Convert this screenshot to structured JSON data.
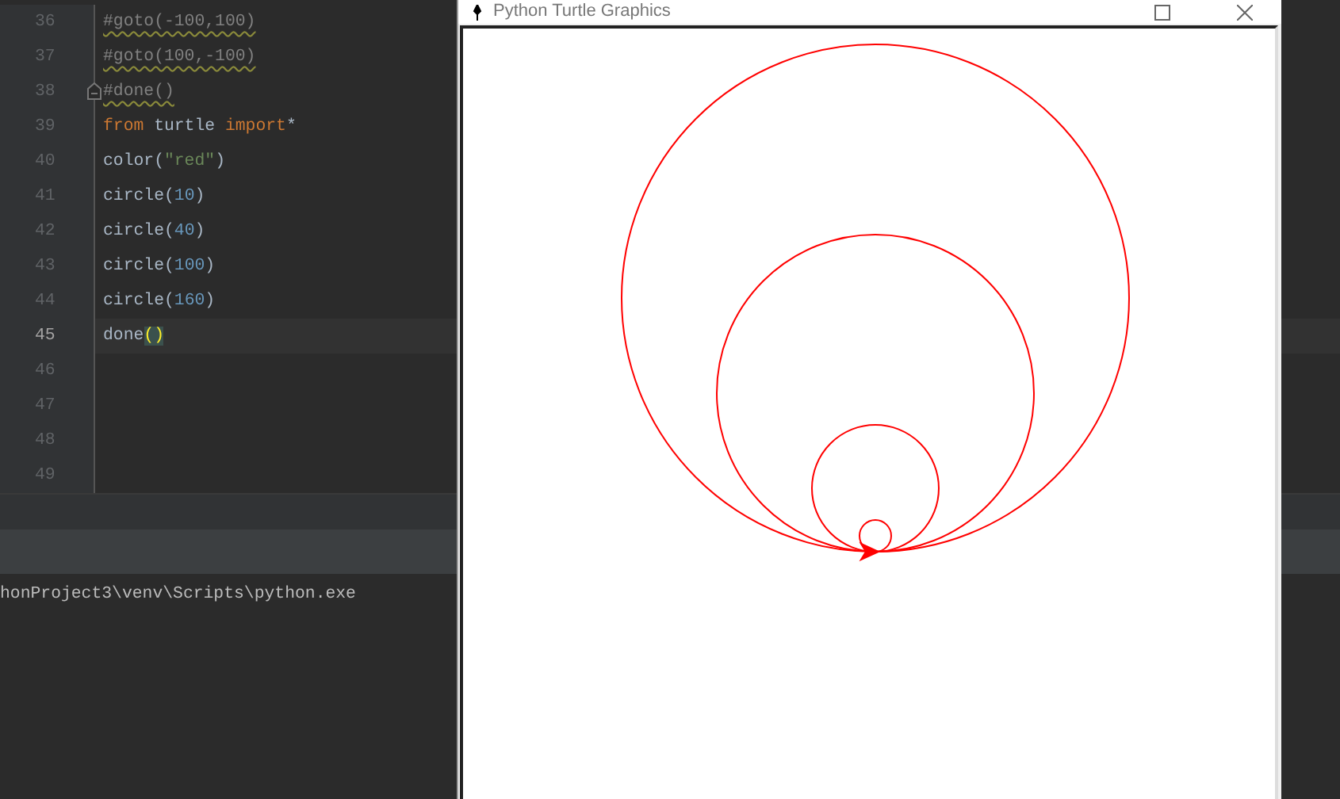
{
  "editor": {
    "lines": [
      {
        "number": "36",
        "current": false,
        "fold": false,
        "tokens": [
          {
            "kind": "comment",
            "text": "#goto(-100,100)"
          }
        ]
      },
      {
        "number": "37",
        "current": false,
        "fold": false,
        "tokens": [
          {
            "kind": "comment",
            "text": "#goto(100,-100)"
          }
        ]
      },
      {
        "number": "38",
        "current": false,
        "fold": true,
        "tokens": [
          {
            "kind": "comment",
            "text": "#done()"
          }
        ]
      },
      {
        "number": "39",
        "current": false,
        "fold": false,
        "tokens": [
          {
            "kind": "keyword",
            "text": "from"
          },
          {
            "kind": "plain",
            "text": " turtle "
          },
          {
            "kind": "keyword",
            "text": "import"
          },
          {
            "kind": "plain",
            "text": "*"
          }
        ]
      },
      {
        "number": "40",
        "current": false,
        "fold": false,
        "tokens": [
          {
            "kind": "plain",
            "text": "color("
          },
          {
            "kind": "string",
            "text": "\"red\""
          },
          {
            "kind": "plain",
            "text": ")"
          }
        ]
      },
      {
        "number": "41",
        "current": false,
        "fold": false,
        "tokens": [
          {
            "kind": "plain",
            "text": "circle("
          },
          {
            "kind": "number",
            "text": "10"
          },
          {
            "kind": "plain",
            "text": ")"
          }
        ]
      },
      {
        "number": "42",
        "current": false,
        "fold": false,
        "tokens": [
          {
            "kind": "plain",
            "text": "circle("
          },
          {
            "kind": "number",
            "text": "40"
          },
          {
            "kind": "plain",
            "text": ")"
          }
        ]
      },
      {
        "number": "43",
        "current": false,
        "fold": false,
        "tokens": [
          {
            "kind": "plain",
            "text": "circle("
          },
          {
            "kind": "number",
            "text": "100"
          },
          {
            "kind": "plain",
            "text": ")"
          }
        ]
      },
      {
        "number": "44",
        "current": false,
        "fold": false,
        "tokens": [
          {
            "kind": "plain",
            "text": "circle("
          },
          {
            "kind": "number",
            "text": "160"
          },
          {
            "kind": "plain",
            "text": ")"
          }
        ]
      },
      {
        "number": "45",
        "current": true,
        "fold": false,
        "tokens": [
          {
            "kind": "plain",
            "text": "done"
          },
          {
            "kind": "brace",
            "text": "()"
          }
        ]
      },
      {
        "number": "46",
        "current": false,
        "fold": false
      },
      {
        "number": "47",
        "current": false,
        "fold": false
      },
      {
        "number": "48",
        "current": false,
        "fold": false
      },
      {
        "number": "49",
        "current": false,
        "fold": false
      }
    ]
  },
  "console": {
    "lines": [
      "honProject3\\venv\\Scripts\\python.exe"
    ]
  },
  "turtle_window": {
    "title": "Python Turtle Graphics"
  }
}
